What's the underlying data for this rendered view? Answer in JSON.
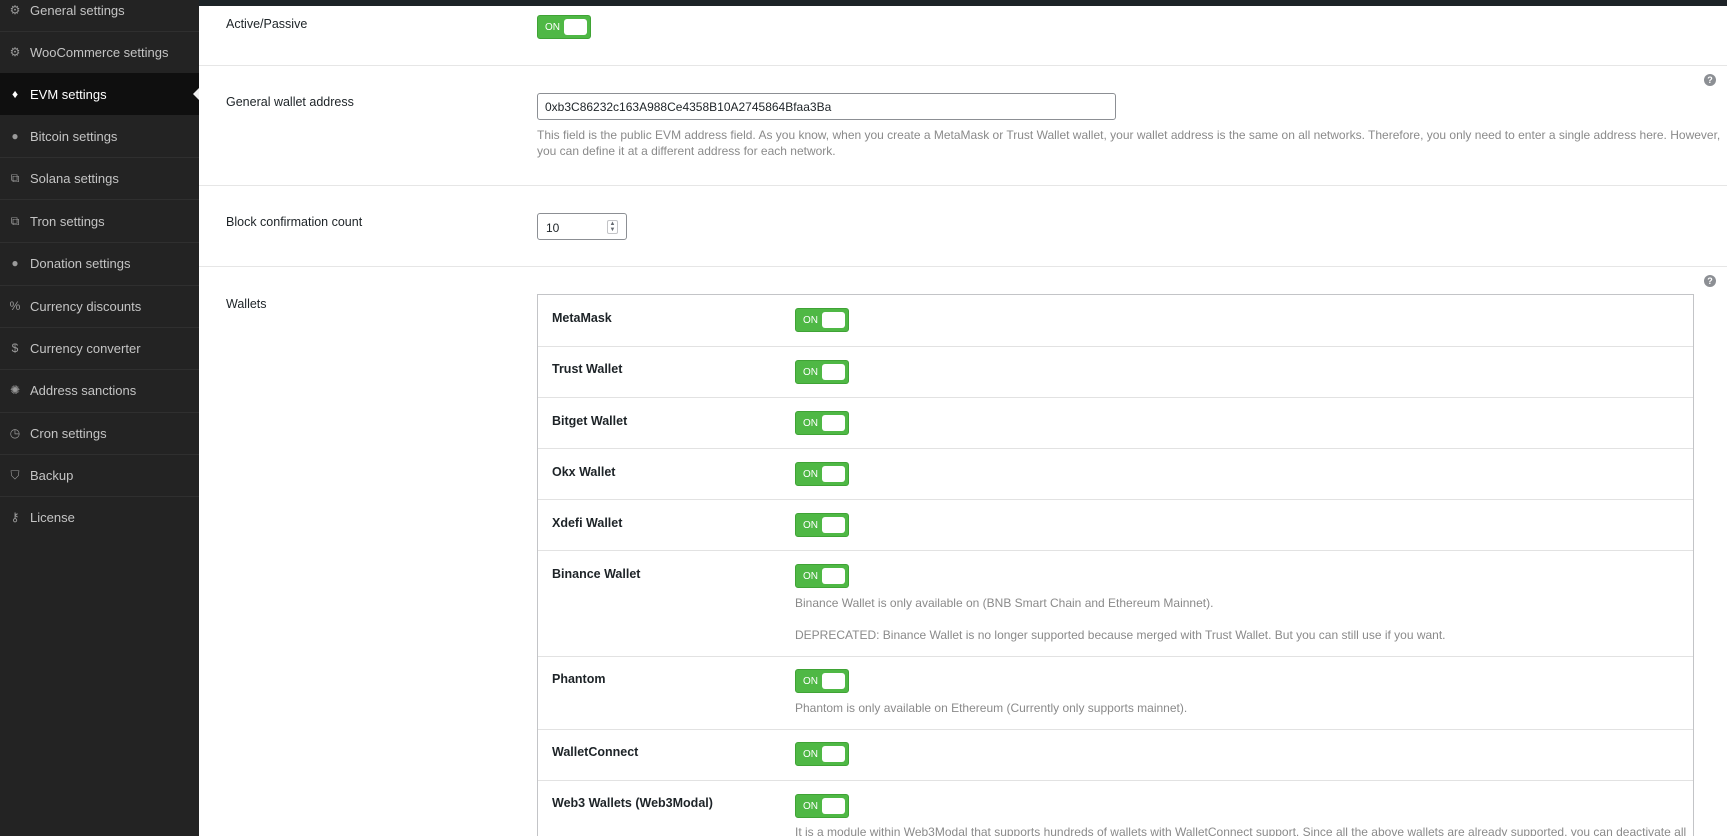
{
  "sidebar": {
    "items": [
      {
        "label": "General settings",
        "icon": "gear-icon"
      },
      {
        "label": "WooCommerce settings",
        "icon": "gear-icon"
      },
      {
        "label": "EVM settings",
        "icon": "ethereum-icon",
        "active": true
      },
      {
        "label": "Bitcoin settings",
        "icon": "bitcoin-icon"
      },
      {
        "label": "Solana settings",
        "icon": "network-icon"
      },
      {
        "label": "Tron settings",
        "icon": "network-icon"
      },
      {
        "label": "Donation settings",
        "icon": "donation-icon"
      },
      {
        "label": "Currency discounts",
        "icon": "percent-icon"
      },
      {
        "label": "Currency converter",
        "icon": "dollar-icon"
      },
      {
        "label": "Address sanctions",
        "icon": "sanctions-icon"
      },
      {
        "label": "Cron settings",
        "icon": "clock-icon"
      },
      {
        "label": "Backup",
        "icon": "shield-icon"
      },
      {
        "label": "License",
        "icon": "key-icon"
      }
    ]
  },
  "settings": {
    "active_passive": {
      "label": "Active/Passive",
      "toggle": "ON"
    },
    "wallet_address": {
      "label": "General wallet address",
      "value": "0xb3C86232c163A988Ce4358B10A2745864Bfaa3Ba",
      "desc_line1": "This field is the public EVM address field. As you know, when you create a MetaMask or Trust Wallet wallet, your wallet address is the same on all networks. Therefore, you only need to enter a single address here. However,",
      "desc_line2": "you can define it at a different address for each network."
    },
    "block_confirmation": {
      "label": "Block confirmation count",
      "value": "10"
    },
    "wallets_label": "Wallets",
    "help_icon": "?"
  },
  "wallets": [
    {
      "name": "MetaMask",
      "toggle": "ON"
    },
    {
      "name": "Trust Wallet",
      "toggle": "ON"
    },
    {
      "name": "Bitget Wallet",
      "toggle": "ON"
    },
    {
      "name": "Okx Wallet",
      "toggle": "ON"
    },
    {
      "name": "Xdefi Wallet",
      "toggle": "ON"
    },
    {
      "name": "Binance Wallet",
      "toggle": "ON",
      "desc1": "Binance Wallet is only available on (BNB Smart Chain and Ethereum Mainnet).",
      "desc2": "DEPRECATED: Binance Wallet is no longer supported because merged with Trust Wallet. But you can still use if you want."
    },
    {
      "name": "Phantom",
      "toggle": "ON",
      "desc1": "Phantom is only available on Ethereum (Currently only supports mainnet)."
    },
    {
      "name": "WalletConnect",
      "toggle": "ON"
    },
    {
      "name": "Web3 Wallets (Web3Modal)",
      "toggle": "ON",
      "desc1": "It is a module within Web3Modal that supports hundreds of wallets with WalletConnect support. Since all the above wallets are already supported, you can deactivate all"
    }
  ],
  "colors": {
    "toggle_on": "#4fb845",
    "sidebar_bg": "#232323",
    "sidebar_active": "#0f0f0f"
  }
}
